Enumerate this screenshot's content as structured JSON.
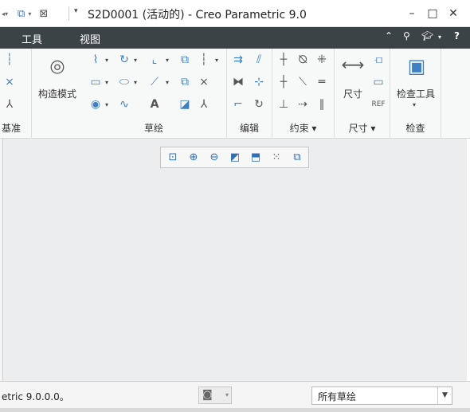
{
  "window": {
    "title": "S2D0001 (活动的) - Creo Parametric 9.0",
    "minimize_glyph": "–",
    "maximize_glyph": "□",
    "close_glyph": "✕"
  },
  "quick_access": {
    "icons": [
      "redo-icon",
      "window-icon",
      "close-window-icon"
    ],
    "customize_glyph": "▾"
  },
  "ribbon_tabs": [
    {
      "label": "工具"
    },
    {
      "label": "视图"
    }
  ],
  "ribbon_right_icons": [
    "minimize-ribbon-icon",
    "search-icon",
    "graduation-icon",
    "help-icon"
  ],
  "groups": {
    "datum": {
      "label": "基准"
    },
    "construction": {
      "label": "构造模式"
    },
    "sketch": {
      "label": "草绘"
    },
    "edit": {
      "label": "编辑"
    },
    "constrain": {
      "label": "约束 ▾"
    },
    "dimension": {
      "label": "尺寸 ▾",
      "big_label": "尺寸"
    },
    "inspect": {
      "label": "检查",
      "big_label": "检查工具"
    }
  },
  "view_toolbar": [
    "refit-icon",
    "zoom-in-icon",
    "zoom-out-icon",
    "display-style-icon",
    "view-orient-icon",
    "sketch-display-filter-icon",
    "sketch-view-icon"
  ],
  "status": {
    "message": "etric 9.0.0.0。",
    "filter_value": "所有草绘"
  },
  "colors": {
    "tabbar": "#3b4346",
    "canvas": "#ebedee",
    "icon_blue": "#3f7fc4"
  }
}
